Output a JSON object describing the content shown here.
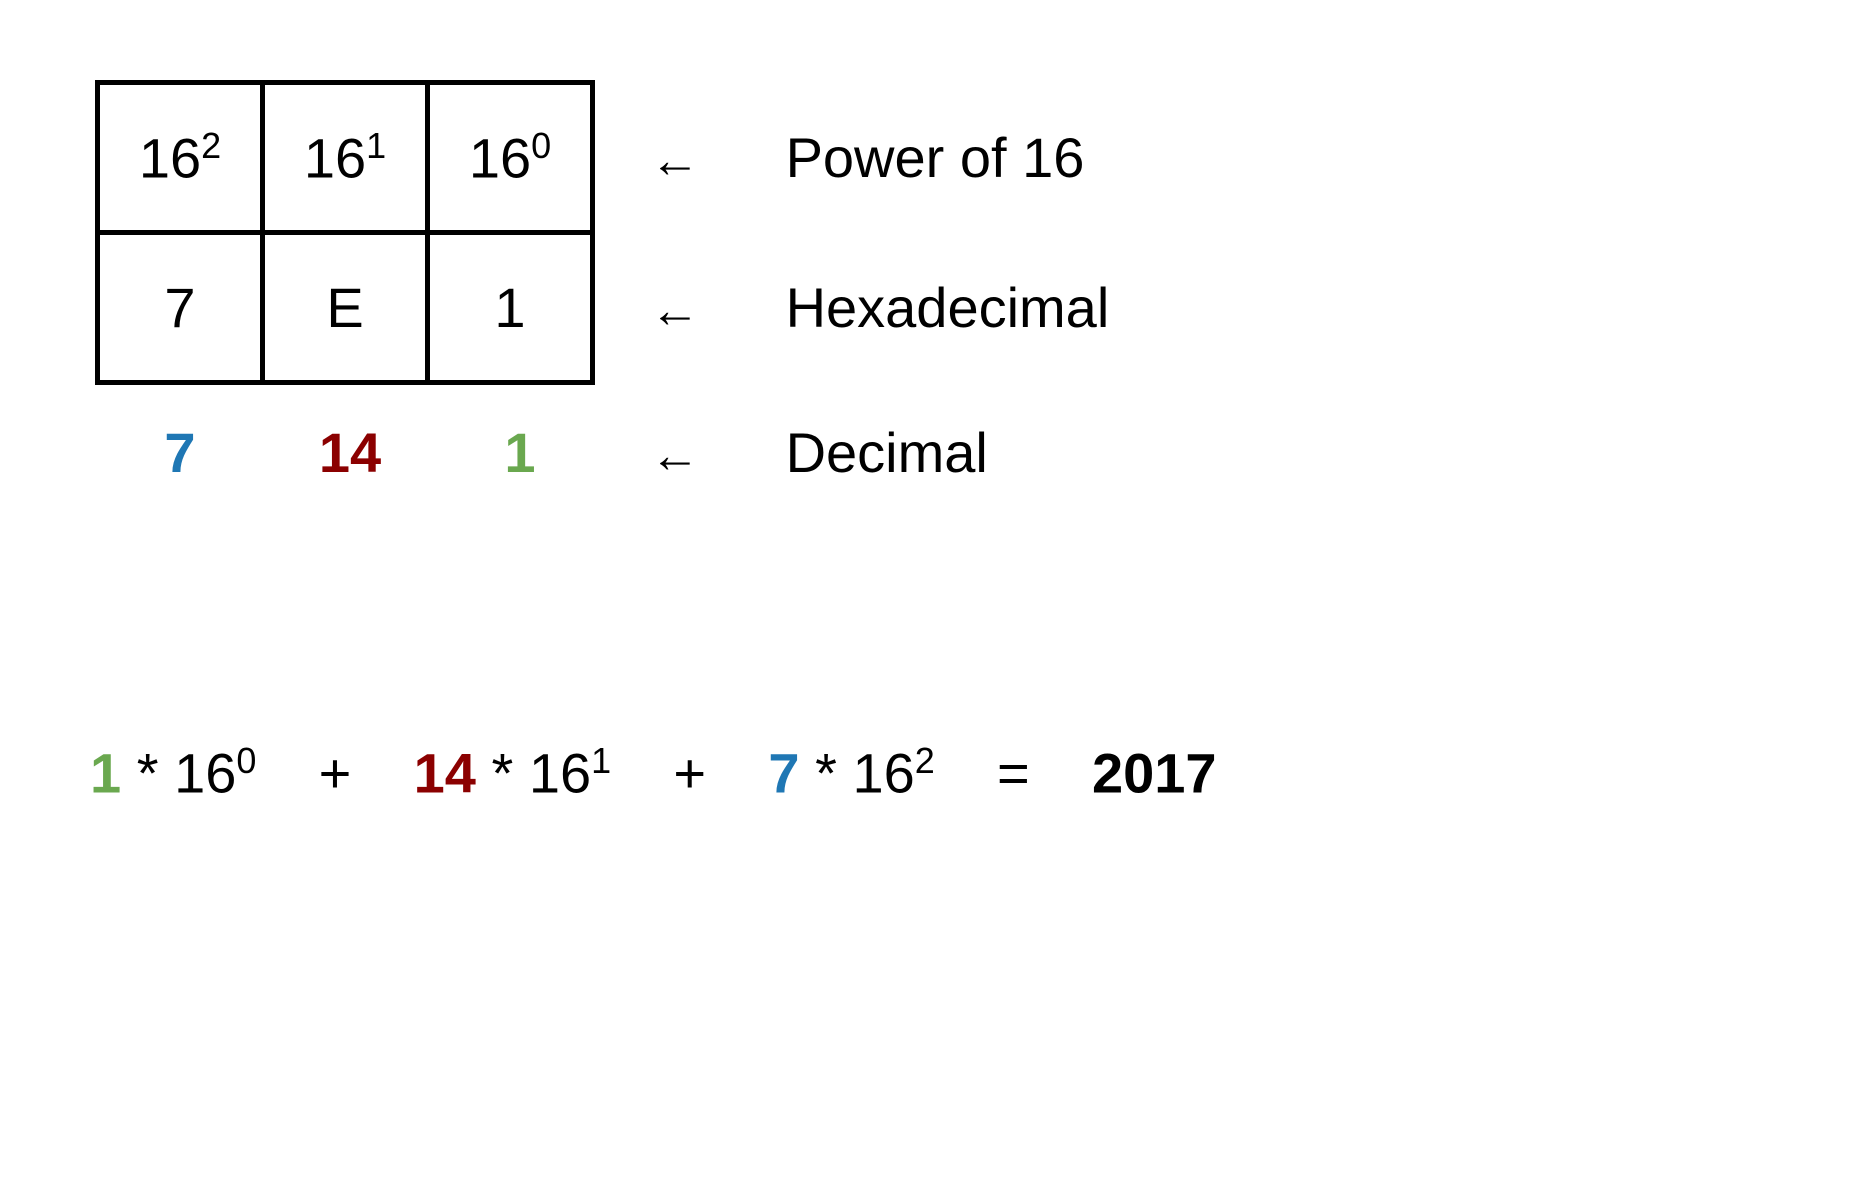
{
  "colors": {
    "blue": "#1f77b4",
    "red": "#8b0000",
    "green": "#6aa84f"
  },
  "powers": {
    "base": "16",
    "exponents": [
      "2",
      "1",
      "0"
    ]
  },
  "hex_digits": [
    "7",
    "E",
    "1"
  ],
  "decimal_digits": [
    {
      "value": "7",
      "color": "blue"
    },
    {
      "value": "14",
      "color": "red"
    },
    {
      "value": "1",
      "color": "green"
    }
  ],
  "labels": {
    "power": "Power of 16",
    "hex": "Hexadecimal",
    "decimal": "Decimal",
    "arrow": "←"
  },
  "equation": {
    "terms": [
      {
        "coef": "1",
        "coef_color": "green",
        "base": "16",
        "exp": "0"
      },
      {
        "coef": "14",
        "coef_color": "red",
        "base": "16",
        "exp": "1"
      },
      {
        "coef": "7",
        "coef_color": "blue",
        "base": "16",
        "exp": "2"
      }
    ],
    "op_mul": "*",
    "op_add": "+",
    "op_eq": "=",
    "result": "2017"
  }
}
